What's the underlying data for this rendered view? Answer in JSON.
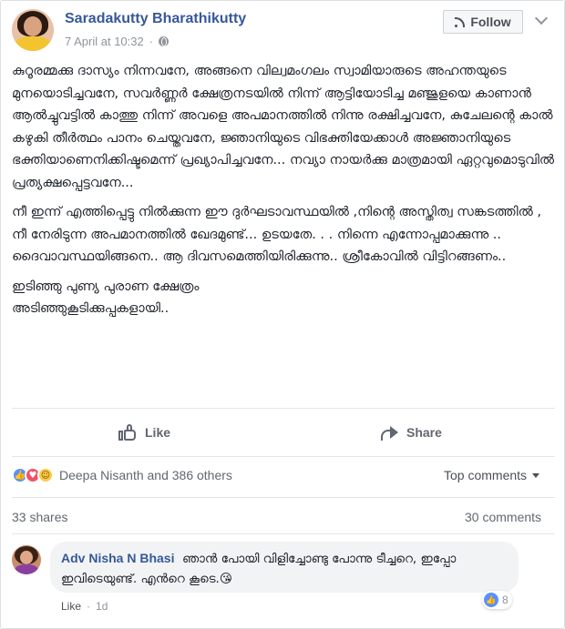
{
  "post": {
    "author": "Saradakutty Bharathikutty",
    "timestamp": "7 April at 10:32",
    "separator": "·",
    "follow_label": "Follow",
    "paragraphs": [
      "കുറൂരമ്മക്കു ദാസ്യം നിന്നവനേ, അങ്ങനെ വില്വമംഗലം സ്വാമിയാരുടെ അഹന്തയുടെ മുനയൊടിച്ചവനേ, സവർണ്ണർ ക്ഷേത്രനടയിൽ നിന്ന് ആട്ടിയോടിച്ച മഞ്ജുളയെ കാണാൻ ആൽച്ചുവട്ടിൽ കാത്തു നിന്ന് അവളെ അപമാനത്തിൽ നിന്നു രക്ഷിച്ചവനേ, കുചേലന്റെ കാൽ കഴുകി തീർത്ഥം പാനം ചെയ്തവനേ, ജ്ഞാനിയുടെ വിഭക്തിയേക്കാൾ അജ്ഞാനിയുടെ ഭക്തിയാണെനിക്കിഷ്ടമെന്ന് പ്രഖ്യാപിച്ചവനേ... നവ്യാ നായർക്കു മാത്രമായി ഏറ്റവുമൊടുവിൽ പ്രത്യക്ഷപ്പെട്ടവനേ...",
      "നീ ഇന്ന് എത്തിപ്പെട്ടു നിൽക്കുന്ന ഈ ദുർഘടാവസ്ഥയിൽ ,നിന്റെ അസ്തിത്വ സങ്കടത്തിൽ , നീ നേരിടുന്ന അപമാനത്തിൽ ഖേദമുണ്ട്... ഉടയതേ. . . നിന്നെ എന്നോപ്പമാക്കുന്നു .. ദൈവാവസ്ഥയിങ്ങനെ.. ആ ദിവസമെത്തിയിരിക്കുന്നു.. ശ്രീകോവിൽ വിട്ടിറങ്ങണം..",
      "ഇടിഞ്ഞു പുണ്യ പുരാണ ക്ഷേത്രം\nഅടിഞ്ഞുകൂടിക്കുപ്പകളായി.."
    ]
  },
  "actions": {
    "like_label": "Like",
    "share_label": "Share"
  },
  "reactions": {
    "names": "Deepa Nisanth and 386 others",
    "top_comments_label": "Top comments"
  },
  "stats": {
    "shares": "33 shares",
    "comments": "30 comments"
  },
  "comment": {
    "author": "Adv Nisha N Bhasi",
    "text": "ഞാൻ പോയി വിളിച്ചോണ്ടു പോന്നു ടീച്ചറെ, ഇപ്പോ ഇവിടെയുണ്ട്. എൻറെ കൂടെ.😘",
    "like_label": "Like",
    "separator": "·",
    "age": "1d",
    "reaction_count": "8"
  }
}
